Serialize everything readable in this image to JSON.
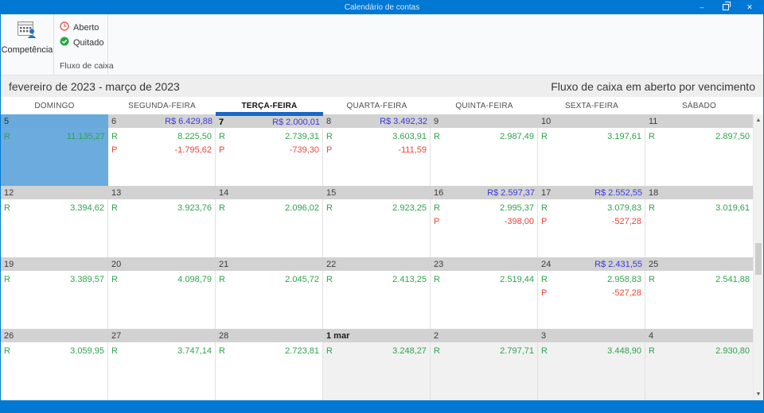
{
  "window": {
    "title": "Calendário de contas",
    "controls": {
      "minimize": "–",
      "close": "✕"
    }
  },
  "ribbon": {
    "competencia_label": "Competência",
    "group_label": "Fluxo de caixa",
    "legend": [
      {
        "label": "Aberto",
        "icon": "clock-icon",
        "color": "#e0614f"
      },
      {
        "label": "Quitado",
        "icon": "check-icon",
        "color": "#27a844"
      }
    ]
  },
  "header": {
    "period": "fevereiro de 2023 - março de 2023",
    "view_title": "Fluxo de caixa em aberto por vencimento"
  },
  "colors": {
    "titlebar": "#0078d4",
    "today_marker": "#1769c6",
    "open_amount_blue": "#3a3ad9",
    "receita_green": "#2fa34c",
    "pagamento_red": "#ee4337",
    "selected_day": "#6babde",
    "day_header_gray": "#d2d2d2"
  },
  "calendar": {
    "weekdays": [
      "DOMINGO",
      "SEGUNDA-FEIRA",
      "TERÇA-FEIRA",
      "QUARTA-FEIRA",
      "QUINTA-FEIRA",
      "SEXTA-FEIRA",
      "SÁBADO"
    ],
    "today_weekday_index": 2,
    "weeks": [
      {
        "days": [
          {
            "day": "5",
            "header_amount": "",
            "selected": true,
            "today": false,
            "other_month": false,
            "month_start": false,
            "lines": [
              {
                "label": "R",
                "amount": "11.135,27"
              }
            ]
          },
          {
            "day": "6",
            "header_amount": "R$ 6.429,88",
            "selected": false,
            "today": false,
            "other_month": false,
            "month_start": false,
            "lines": [
              {
                "label": "R",
                "amount": "8.225,50"
              },
              {
                "label": "P",
                "amount": "-1.795,62"
              }
            ]
          },
          {
            "day": "7",
            "header_amount": "R$ 2.000,01",
            "selected": false,
            "today": true,
            "other_month": false,
            "month_start": false,
            "lines": [
              {
                "label": "R",
                "amount": "2.739,31"
              },
              {
                "label": "P",
                "amount": "-739,30"
              }
            ]
          },
          {
            "day": "8",
            "header_amount": "R$ 3.492,32",
            "selected": false,
            "today": false,
            "other_month": false,
            "month_start": false,
            "lines": [
              {
                "label": "R",
                "amount": "3.603,91"
              },
              {
                "label": "P",
                "amount": "-111,59"
              }
            ]
          },
          {
            "day": "9",
            "header_amount": "",
            "selected": false,
            "today": false,
            "other_month": false,
            "month_start": false,
            "lines": [
              {
                "label": "R",
                "amount": "2.987,49"
              }
            ]
          },
          {
            "day": "10",
            "header_amount": "",
            "selected": false,
            "today": false,
            "other_month": false,
            "month_start": false,
            "lines": [
              {
                "label": "R",
                "amount": "3.197,61"
              }
            ]
          },
          {
            "day": "11",
            "header_amount": "",
            "selected": false,
            "today": false,
            "other_month": false,
            "month_start": false,
            "lines": [
              {
                "label": "R",
                "amount": "2.897,50"
              }
            ]
          }
        ]
      },
      {
        "days": [
          {
            "day": "12",
            "header_amount": "",
            "selected": false,
            "today": false,
            "other_month": false,
            "month_start": false,
            "lines": [
              {
                "label": "R",
                "amount": "3.394,62"
              }
            ]
          },
          {
            "day": "13",
            "header_amount": "",
            "selected": false,
            "today": false,
            "other_month": false,
            "month_start": false,
            "lines": [
              {
                "label": "R",
                "amount": "3.923,76"
              }
            ]
          },
          {
            "day": "14",
            "header_amount": "",
            "selected": false,
            "today": false,
            "other_month": false,
            "month_start": false,
            "lines": [
              {
                "label": "R",
                "amount": "2.096,02"
              }
            ]
          },
          {
            "day": "15",
            "header_amount": "",
            "selected": false,
            "today": false,
            "other_month": false,
            "month_start": false,
            "lines": [
              {
                "label": "R",
                "amount": "2.923,25"
              }
            ]
          },
          {
            "day": "16",
            "header_amount": "R$ 2.597,37",
            "selected": false,
            "today": false,
            "other_month": false,
            "month_start": false,
            "lines": [
              {
                "label": "R",
                "amount": "2.995,37"
              },
              {
                "label": "P",
                "amount": "-398,00"
              }
            ]
          },
          {
            "day": "17",
            "header_amount": "R$ 2.552,55",
            "selected": false,
            "today": false,
            "other_month": false,
            "month_start": false,
            "lines": [
              {
                "label": "R",
                "amount": "3.079,83"
              },
              {
                "label": "P",
                "amount": "-527,28"
              }
            ]
          },
          {
            "day": "18",
            "header_amount": "",
            "selected": false,
            "today": false,
            "other_month": false,
            "month_start": false,
            "lines": [
              {
                "label": "R",
                "amount": "3.019,61"
              }
            ]
          }
        ]
      },
      {
        "days": [
          {
            "day": "19",
            "header_amount": "",
            "selected": false,
            "today": false,
            "other_month": false,
            "month_start": false,
            "lines": [
              {
                "label": "R",
                "amount": "3.389,57"
              }
            ]
          },
          {
            "day": "20",
            "header_amount": "",
            "selected": false,
            "today": false,
            "other_month": false,
            "month_start": false,
            "lines": [
              {
                "label": "R",
                "amount": "4.098,79"
              }
            ]
          },
          {
            "day": "21",
            "header_amount": "",
            "selected": false,
            "today": false,
            "other_month": false,
            "month_start": false,
            "lines": [
              {
                "label": "R",
                "amount": "2.045,72"
              }
            ]
          },
          {
            "day": "22",
            "header_amount": "",
            "selected": false,
            "today": false,
            "other_month": false,
            "month_start": false,
            "lines": [
              {
                "label": "R",
                "amount": "2.413,25"
              }
            ]
          },
          {
            "day": "23",
            "header_amount": "",
            "selected": false,
            "today": false,
            "other_month": false,
            "month_start": false,
            "lines": [
              {
                "label": "R",
                "amount": "2.519,44"
              }
            ]
          },
          {
            "day": "24",
            "header_amount": "R$ 2.431,55",
            "selected": false,
            "today": false,
            "other_month": false,
            "month_start": false,
            "lines": [
              {
                "label": "R",
                "amount": "2.958,83"
              },
              {
                "label": "P",
                "amount": "-527,28"
              }
            ]
          },
          {
            "day": "25",
            "header_amount": "",
            "selected": false,
            "today": false,
            "other_month": false,
            "month_start": false,
            "lines": [
              {
                "label": "R",
                "amount": "2.541,88"
              }
            ]
          }
        ]
      },
      {
        "days": [
          {
            "day": "26",
            "header_amount": "",
            "selected": false,
            "today": false,
            "other_month": false,
            "month_start": false,
            "lines": [
              {
                "label": "R",
                "amount": "3.059,95"
              }
            ]
          },
          {
            "day": "27",
            "header_amount": "",
            "selected": false,
            "today": false,
            "other_month": false,
            "month_start": false,
            "lines": [
              {
                "label": "R",
                "amount": "3.747,14"
              }
            ]
          },
          {
            "day": "28",
            "header_amount": "",
            "selected": false,
            "today": false,
            "other_month": false,
            "month_start": false,
            "lines": [
              {
                "label": "R",
                "amount": "2.723,81"
              }
            ]
          },
          {
            "day": "1 mar",
            "header_amount": "",
            "selected": false,
            "today": false,
            "other_month": true,
            "month_start": true,
            "lines": [
              {
                "label": "R",
                "amount": "3.248,27"
              }
            ]
          },
          {
            "day": "2",
            "header_amount": "",
            "selected": false,
            "today": false,
            "other_month": true,
            "month_start": false,
            "lines": [
              {
                "label": "R",
                "amount": "2.797,71"
              }
            ]
          },
          {
            "day": "3",
            "header_amount": "",
            "selected": false,
            "today": false,
            "other_month": true,
            "month_start": false,
            "lines": [
              {
                "label": "R",
                "amount": "3.448,90"
              }
            ]
          },
          {
            "day": "4",
            "header_amount": "",
            "selected": false,
            "today": false,
            "other_month": true,
            "month_start": false,
            "lines": [
              {
                "label": "R",
                "amount": "2.930,80"
              }
            ]
          }
        ]
      }
    ]
  }
}
